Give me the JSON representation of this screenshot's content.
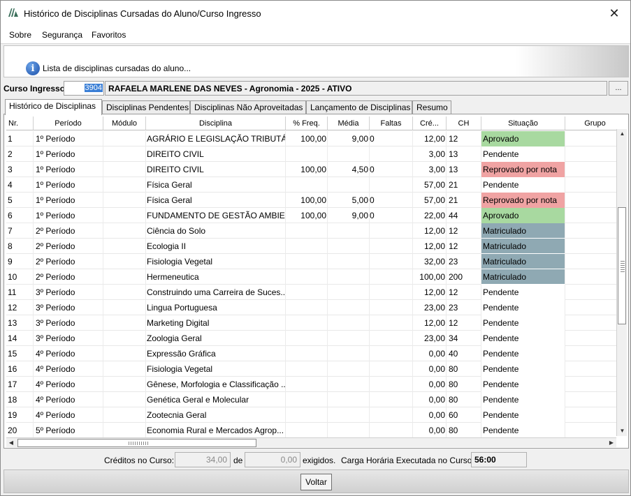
{
  "window": {
    "title": "Histórico de Disciplinas Cursadas do Aluno/Curso Ingresso",
    "close_glyph": "✕"
  },
  "menu": [
    "Sobre",
    "Segurança",
    "Favoritos"
  ],
  "info": {
    "text": "Lista de disciplinas cursadas do aluno...",
    "icon": "info-icon"
  },
  "curso": {
    "label": "Curso Ingresso:",
    "code": "3904",
    "description": "RAFAELA MARLENE DAS NEVES - Agronomia - 2025 - ATIVO",
    "lookup_label": "..."
  },
  "tabs": [
    "Histórico de Disciplinas",
    "Disciplinas Pendentes",
    "Disciplinas Não Aproveitadas",
    "Lançamento de Disciplinas",
    "Resumo"
  ],
  "columns": [
    "Nr.",
    "Período",
    "Módulo",
    "Disciplina",
    "% Freq.",
    "Média",
    "Faltas",
    "Cré...",
    "CH",
    "Situação",
    "Grupo"
  ],
  "status_colors": {
    "Aprovado": "#a8d9a0",
    "Reprovado por nota": "#f0a3a3",
    "Matriculado": "#8fa9b3",
    "Pendente": "#ffffff"
  },
  "rows": [
    {
      "nr": "1",
      "periodo": "1º Período",
      "modulo": "",
      "disciplina": "AGRÁRIO E LEGISLAÇÃO TRIBUTÁRIA",
      "freq": "100,00",
      "media": "9,00",
      "faltas": "0",
      "creditos": "12,00",
      "ch": "12",
      "situacao": "Aprovado",
      "grupo": ""
    },
    {
      "nr": "2",
      "periodo": "1º Período",
      "modulo": "",
      "disciplina": "DIREITO CIVIL",
      "freq": "",
      "media": "",
      "faltas": "",
      "creditos": "3,00",
      "ch": "13",
      "situacao": "Pendente",
      "grupo": ""
    },
    {
      "nr": "3",
      "periodo": "1º Período",
      "modulo": "",
      "disciplina": "DIREITO CIVIL",
      "freq": "100,00",
      "media": "4,50",
      "faltas": "0",
      "creditos": "3,00",
      "ch": "13",
      "situacao": "Reprovado por nota",
      "grupo": ""
    },
    {
      "nr": "4",
      "periodo": "1º Período",
      "modulo": "",
      "disciplina": "Física Geral",
      "freq": "",
      "media": "",
      "faltas": "",
      "creditos": "57,00",
      "ch": "21",
      "situacao": "Pendente",
      "grupo": ""
    },
    {
      "nr": "5",
      "periodo": "1º Período",
      "modulo": "",
      "disciplina": "Física Geral",
      "freq": "100,00",
      "media": "5,00",
      "faltas": "0",
      "creditos": "57,00",
      "ch": "21",
      "situacao": "Reprovado por nota",
      "grupo": ""
    },
    {
      "nr": "6",
      "periodo": "1º Período",
      "modulo": "",
      "disciplina": "FUNDAMENTO DE GESTÃO AMBIE...",
      "freq": "100,00",
      "media": "9,00",
      "faltas": "0",
      "creditos": "22,00",
      "ch": "44",
      "situacao": "Aprovado",
      "grupo": ""
    },
    {
      "nr": "7",
      "periodo": "2º Período",
      "modulo": "",
      "disciplina": "Ciência do Solo",
      "freq": "",
      "media": "",
      "faltas": "",
      "creditos": "12,00",
      "ch": "12",
      "situacao": "Matriculado",
      "grupo": ""
    },
    {
      "nr": "8",
      "periodo": "2º Período",
      "modulo": "",
      "disciplina": "Ecologia II",
      "freq": "",
      "media": "",
      "faltas": "",
      "creditos": "12,00",
      "ch": "12",
      "situacao": "Matriculado",
      "grupo": ""
    },
    {
      "nr": "9",
      "periodo": "2º Período",
      "modulo": "",
      "disciplina": "Fisiologia Vegetal",
      "freq": "",
      "media": "",
      "faltas": "",
      "creditos": "32,00",
      "ch": "23",
      "situacao": "Matriculado",
      "grupo": ""
    },
    {
      "nr": "10",
      "periodo": "2º Período",
      "modulo": "",
      "disciplina": "Hermeneutica",
      "freq": "",
      "media": "",
      "faltas": "",
      "creditos": "100,00",
      "ch": "200",
      "situacao": "Matriculado",
      "grupo": ""
    },
    {
      "nr": "11",
      "periodo": "3º Período",
      "modulo": "",
      "disciplina": "Construindo uma Carreira de Suces...",
      "freq": "",
      "media": "",
      "faltas": "",
      "creditos": "12,00",
      "ch": "12",
      "situacao": "Pendente",
      "grupo": ""
    },
    {
      "nr": "12",
      "periodo": "3º Período",
      "modulo": "",
      "disciplina": "Lingua Portuguesa",
      "freq": "",
      "media": "",
      "faltas": "",
      "creditos": "23,00",
      "ch": "23",
      "situacao": "Pendente",
      "grupo": ""
    },
    {
      "nr": "13",
      "periodo": "3º Período",
      "modulo": "",
      "disciplina": "Marketing Digital",
      "freq": "",
      "media": "",
      "faltas": "",
      "creditos": "12,00",
      "ch": "12",
      "situacao": "Pendente",
      "grupo": ""
    },
    {
      "nr": "14",
      "periodo": "3º Período",
      "modulo": "",
      "disciplina": "Zoologia Geral",
      "freq": "",
      "media": "",
      "faltas": "",
      "creditos": "23,00",
      "ch": "34",
      "situacao": "Pendente",
      "grupo": ""
    },
    {
      "nr": "15",
      "periodo": "4º Período",
      "modulo": "",
      "disciplina": "Expressão Gráfica",
      "freq": "",
      "media": "",
      "faltas": "",
      "creditos": "0,00",
      "ch": "40",
      "situacao": "Pendente",
      "grupo": ""
    },
    {
      "nr": "16",
      "periodo": "4º Período",
      "modulo": "",
      "disciplina": "Fisiologia Vegetal",
      "freq": "",
      "media": "",
      "faltas": "",
      "creditos": "0,00",
      "ch": "80",
      "situacao": "Pendente",
      "grupo": ""
    },
    {
      "nr": "17",
      "periodo": "4º Período",
      "modulo": "",
      "disciplina": "Gênese, Morfologia e Classificação ...",
      "freq": "",
      "media": "",
      "faltas": "",
      "creditos": "0,00",
      "ch": "80",
      "situacao": "Pendente",
      "grupo": ""
    },
    {
      "nr": "18",
      "periodo": "4º Período",
      "modulo": "",
      "disciplina": "Genética Geral e Molecular",
      "freq": "",
      "media": "",
      "faltas": "",
      "creditos": "0,00",
      "ch": "80",
      "situacao": "Pendente",
      "grupo": ""
    },
    {
      "nr": "19",
      "periodo": "4º Período",
      "modulo": "",
      "disciplina": "Zootecnia Geral",
      "freq": "",
      "media": "",
      "faltas": "",
      "creditos": "0,00",
      "ch": "60",
      "situacao": "Pendente",
      "grupo": ""
    },
    {
      "nr": "20",
      "periodo": "5º Período",
      "modulo": "",
      "disciplina": "Economia Rural e Mercados Agrop...",
      "freq": "",
      "media": "",
      "faltas": "",
      "creditos": "0,00",
      "ch": "80",
      "situacao": "Pendente",
      "grupo": ""
    }
  ],
  "footer": {
    "creditos_label": "Créditos no Curso:",
    "creditos_value": "34,00",
    "de_label": "de",
    "exigidos_value": "0,00",
    "exigidos_label": "exigidos.",
    "carga_label": "Carga Horária Executada no Curso:",
    "carga_value": "56:00"
  },
  "buttons": {
    "voltar": "Voltar"
  }
}
